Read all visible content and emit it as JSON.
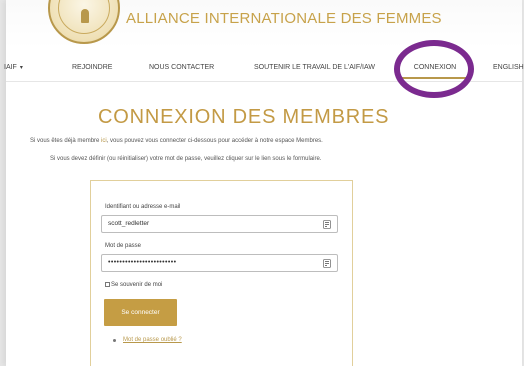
{
  "header": {
    "title": "ALLIANCE INTERNATIONALE DES FEMMES"
  },
  "nav": {
    "items": [
      {
        "label": "IAIF"
      },
      {
        "label": "REJOINDRE"
      },
      {
        "label": "NOUS CONTACTER"
      },
      {
        "label": "SOUTENIR LE TRAVAIL DE L'AIF/IAW"
      },
      {
        "label": "CONNEXION"
      },
      {
        "label": "ENGLISH"
      }
    ],
    "caret": "▾"
  },
  "main": {
    "heading": "CONNEXION DES MEMBRES",
    "intro_line1_before": "Si vous êtes déjà membre ",
    "intro_line1_link": "ici",
    "intro_line1_after": ", vous pouvez vous connecter ci-dessous pour accéder à notre espace Membres.",
    "intro_line2": "Si vous devez définir (ou réinitialiser) votre mot de passe, veuillez cliquer sur le lien sous le formulaire."
  },
  "login_form": {
    "username_label": "Identifiant ou adresse e-mail",
    "username_value": "scott_redletter",
    "password_label": "Mot de passe",
    "password_value": "••••••••••••••••••••••••",
    "remember_label": "Se souvenir de moi",
    "submit_label": "Se connecter",
    "forgot_label": "Mot de passe oublié ?"
  },
  "colors": {
    "accent_gold": "#c59d44",
    "highlight_ring": "#7b2a8f"
  }
}
